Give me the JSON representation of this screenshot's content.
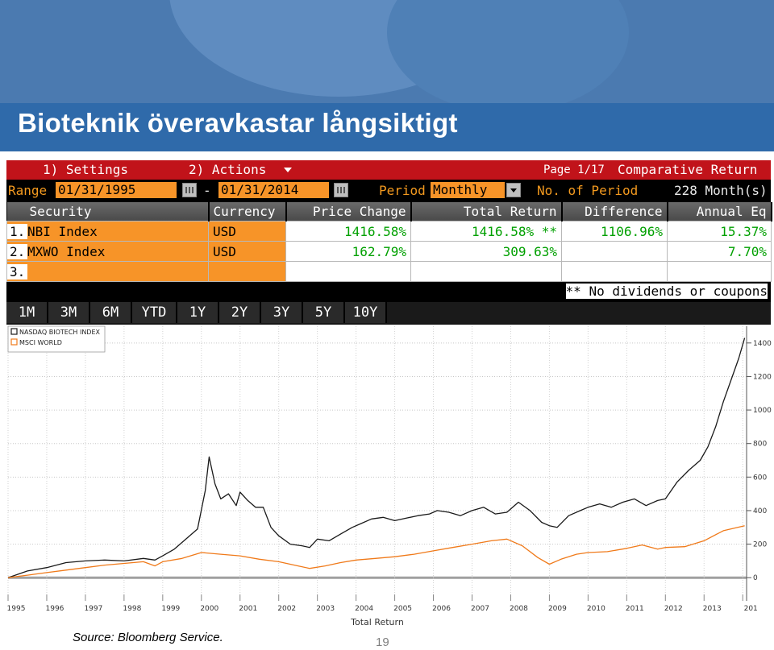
{
  "slide": {
    "title": "Bioteknik överavkastar långsiktigt",
    "source": "Source: Bloomberg Service.",
    "page_number": "19",
    "colors": {
      "banner": "#4b7ab0",
      "title_bar": "#2f6aaa",
      "menu_red": "#c1131a",
      "field_orange": "#f79428",
      "price_green": "#00a000",
      "nbi_line": "#1a1a1a",
      "msci_line": "#f07a1a"
    }
  },
  "terminal": {
    "menu": {
      "settings": "1) Settings",
      "actions": "2) Actions",
      "page": "Page 1/17",
      "title": "Comparative Return"
    },
    "range": {
      "label": "Range",
      "start": "01/31/1995",
      "dash": "-",
      "end": "01/31/2014",
      "period_label": "Period",
      "period_value": "Monthly",
      "num_label": "No. of Period",
      "num_value": "228 Month(s)"
    },
    "columns": [
      "Security",
      "Currency",
      "Price Change",
      "Total Return",
      "Difference",
      "Annual Eq"
    ],
    "rows": [
      {
        "idx": "1.",
        "security": "NBI Index",
        "currency": "USD",
        "price_change": "1416.58%",
        "total_return": "1416.58% **",
        "difference": "1106.96%",
        "annual_eq": "15.37%"
      },
      {
        "idx": "2.",
        "security": "MXWO Index",
        "currency": "USD",
        "price_change": "162.79%",
        "total_return": "309.63%",
        "difference": "",
        "annual_eq": "7.70%"
      },
      {
        "idx": "3.",
        "security": "",
        "currency": "",
        "price_change": "",
        "total_return": "",
        "difference": "",
        "annual_eq": ""
      }
    ],
    "note": "** No dividends or coupons",
    "period_buttons": [
      "1M",
      "3M",
      "6M",
      "YTD",
      "1Y",
      "2Y",
      "3Y",
      "5Y",
      "10Y"
    ]
  },
  "chart_data": {
    "type": "line",
    "title": "",
    "xlabel": "Total Return",
    "ylabel": "",
    "xlim": [
      1995.0,
      2014.1
    ],
    "ylim": [
      -100,
      1500
    ],
    "x_ticks": [
      "1995",
      "1996",
      "1997",
      "1998",
      "1999",
      "2000",
      "2001",
      "2002",
      "2003",
      "2004",
      "2005",
      "2006",
      "2007",
      "2008",
      "2009",
      "2010",
      "2011",
      "2012",
      "2013",
      "201"
    ],
    "y_ticks": [
      "1400",
      "1200",
      "1000",
      "800",
      "600",
      "400",
      "200",
      "0"
    ],
    "legend": [
      "NASDAQ BIOTECH INDEX",
      "MSCI WORLD"
    ],
    "legend_position": "top-left",
    "series": [
      {
        "name": "NASDAQ BIOTECH INDEX",
        "color": "#1a1a1a",
        "x": [
          1995.0,
          1995.5,
          1996.0,
          1996.5,
          1997.0,
          1997.5,
          1998.0,
          1998.5,
          1998.8,
          1999.0,
          1999.3,
          1999.6,
          1999.9,
          2000.1,
          2000.2,
          2000.35,
          2000.5,
          2000.7,
          2000.9,
          2001.0,
          2001.2,
          2001.4,
          2001.6,
          2001.8,
          2002.0,
          2002.3,
          2002.6,
          2002.8,
          2003.0,
          2003.3,
          2003.6,
          2003.9,
          2004.1,
          2004.4,
          2004.7,
          2005.0,
          2005.3,
          2005.6,
          2005.9,
          2006.1,
          2006.4,
          2006.7,
          2007.0,
          2007.3,
          2007.6,
          2007.9,
          2008.2,
          2008.5,
          2008.8,
          2009.0,
          2009.2,
          2009.5,
          2009.8,
          2010.0,
          2010.3,
          2010.6,
          2010.9,
          2011.2,
          2011.5,
          2011.8,
          2012.0,
          2012.3,
          2012.6,
          2012.9,
          2013.1,
          2013.3,
          2013.5,
          2013.7,
          2013.9,
          2014.05
        ],
        "y": [
          0,
          40,
          60,
          90,
          100,
          105,
          100,
          115,
          105,
          130,
          170,
          230,
          290,
          520,
          720,
          560,
          470,
          500,
          430,
          510,
          460,
          420,
          420,
          300,
          250,
          200,
          190,
          180,
          230,
          220,
          260,
          300,
          320,
          350,
          360,
          340,
          355,
          370,
          380,
          400,
          390,
          370,
          400,
          420,
          380,
          390,
          450,
          400,
          330,
          310,
          300,
          370,
          400,
          420,
          440,
          420,
          450,
          470,
          430,
          460,
          470,
          570,
          640,
          700,
          780,
          900,
          1050,
          1180,
          1310,
          1430
        ]
      },
      {
        "name": "MSCI WORLD",
        "color": "#f07a1a",
        "x": [
          1995.0,
          1995.5,
          1996.0,
          1996.5,
          1997.0,
          1997.5,
          1998.0,
          1998.5,
          1998.8,
          1999.0,
          1999.5,
          2000.0,
          2000.5,
          2001.0,
          2001.5,
          2002.0,
          2002.5,
          2002.8,
          2003.2,
          2003.6,
          2004.0,
          2004.5,
          2005.0,
          2005.5,
          2006.0,
          2006.5,
          2007.0,
          2007.5,
          2007.9,
          2008.3,
          2008.7,
          2009.0,
          2009.3,
          2009.7,
          2010.0,
          2010.5,
          2011.0,
          2011.4,
          2011.8,
          2012.0,
          2012.5,
          2013.0,
          2013.5,
          2014.05
        ],
        "y": [
          0,
          15,
          30,
          45,
          60,
          75,
          85,
          95,
          70,
          95,
          115,
          150,
          140,
          130,
          110,
          95,
          70,
          55,
          70,
          90,
          105,
          115,
          125,
          140,
          160,
          180,
          200,
          220,
          230,
          190,
          120,
          80,
          110,
          140,
          150,
          155,
          175,
          195,
          170,
          180,
          185,
          220,
          280,
          310
        ]
      }
    ]
  }
}
